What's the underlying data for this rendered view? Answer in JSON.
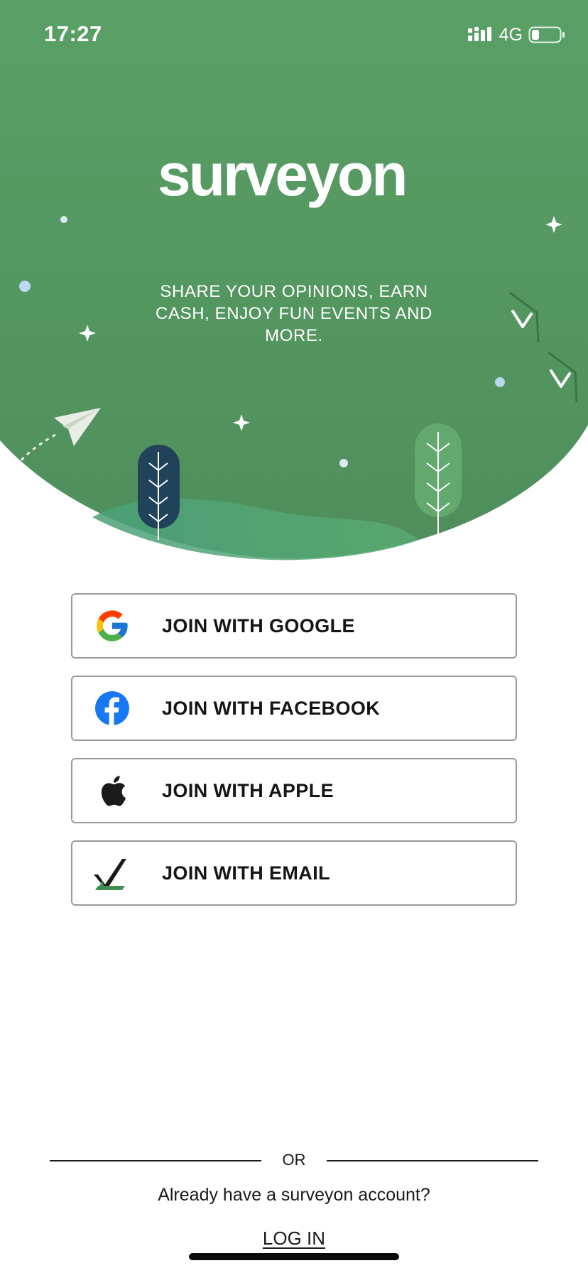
{
  "status_bar": {
    "time": "17:27",
    "network": "4G",
    "battery_level": 0.25
  },
  "brand": {
    "logo_text": "surveyon",
    "tagline": "SHARE YOUR OPINIONS, EARN CASH, ENJOY FUN EVENTS AND MORE."
  },
  "join_options": [
    {
      "label": "JOIN WITH GOOGLE",
      "icon": "google-icon"
    },
    {
      "label": "JOIN WITH FACEBOOK",
      "icon": "facebook-icon"
    },
    {
      "label": "JOIN WITH APPLE",
      "icon": "apple-icon"
    },
    {
      "label": "JOIN WITH EMAIL",
      "icon": "email-checkmark-icon"
    }
  ],
  "footer": {
    "divider_text": "OR",
    "account_prompt": "Already have a surveyon account?",
    "login_label": "LOG IN"
  },
  "colors": {
    "hero_green": "#55995f",
    "accent_dark_tree": "#21435a",
    "light_green_tree": "#5fa56a",
    "facebook_blue": "#1877f2",
    "border_gray": "#9a9a9a"
  }
}
